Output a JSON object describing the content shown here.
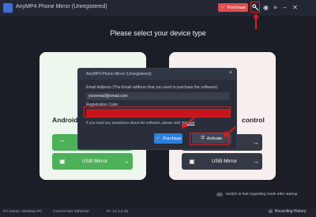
{
  "window": {
    "title": "AnyMP4 Phone Mirror (Unregistered)",
    "purchase_label": "Purchase",
    "icons": [
      "key-icon",
      "user-icon",
      "menu-icon",
      "minimize-icon",
      "close-icon"
    ]
  },
  "main": {
    "heading": "Please select your device type",
    "android_card": {
      "title": "Android",
      "wifi_label": "W",
      "usb_label": "USB Mirror"
    },
    "ios_card": {
      "title": "control",
      "wifi_label": "",
      "usb_label": "USB Mirror"
    }
  },
  "dialog": {
    "title": "AnyMP4 Phone Mirror (Unregistered)",
    "email_label": "Email Address (The Email address that you used to purchase the software):",
    "email_value": "youremail@email.com",
    "code_label": "Registration Code:",
    "code_value": "",
    "help_text": "If you need any assistance about the software, please visit:",
    "help_link": "Support",
    "purchase_label": "Purchase",
    "activate_label": "Activate"
  },
  "footer": {
    "switch_label": "Switch to fast regarding mode after startup",
    "pc_name": "PC Name: Desktop-PC",
    "current_net": "Current Net: Ethernet",
    "ip": "IP: 10.1.2.15",
    "history_label": "Recording History"
  },
  "colors": {
    "accent_red": "#e21c1c",
    "green": "#4fb05a",
    "blue": "#2d7fdc"
  }
}
